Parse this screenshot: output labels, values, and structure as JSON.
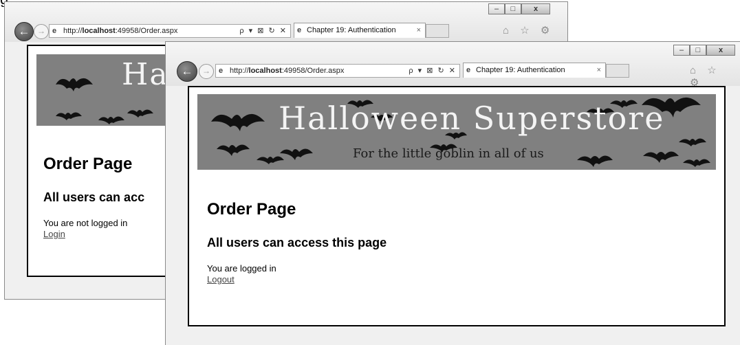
{
  "back_window": {
    "address_url_prefix": "http://",
    "address_url_host": "localhost",
    "address_url_rest": ":49958/Order.aspx",
    "address_tools": "ρ ▾ ⊠ ↻ ✕",
    "tab_title": "Chapter 19: Authentication",
    "tab_close": "×",
    "banner_title": "Hal",
    "heading": "Order Page",
    "subheading": "All users can acc",
    "status_text": "You are not logged in",
    "link_text": "Login",
    "right_icons": "⌂ ☆ ⚙"
  },
  "front_window": {
    "address_url_prefix": "http://",
    "address_url_host": "localhost",
    "address_url_rest": ":49958/Order.aspx",
    "address_tools": "ρ ▾ ⊠ ↻ ✕",
    "tab_title": "Chapter 19: Authentication",
    "tab_close": "×",
    "banner_title": "Halloween Superstore",
    "banner_tagline": "For the little goblin in all of us",
    "heading": "Order Page",
    "subheading": "All users can access this page",
    "status_text": "You are logged in",
    "link_text": "Logout",
    "right_icons": "⌂ ☆ ⚙"
  },
  "window_buttons": {
    "minimize": "–",
    "maximize": "□",
    "close": "x"
  },
  "colors": {
    "banner": "#808080",
    "bat": "#111111",
    "link": "#444444"
  }
}
